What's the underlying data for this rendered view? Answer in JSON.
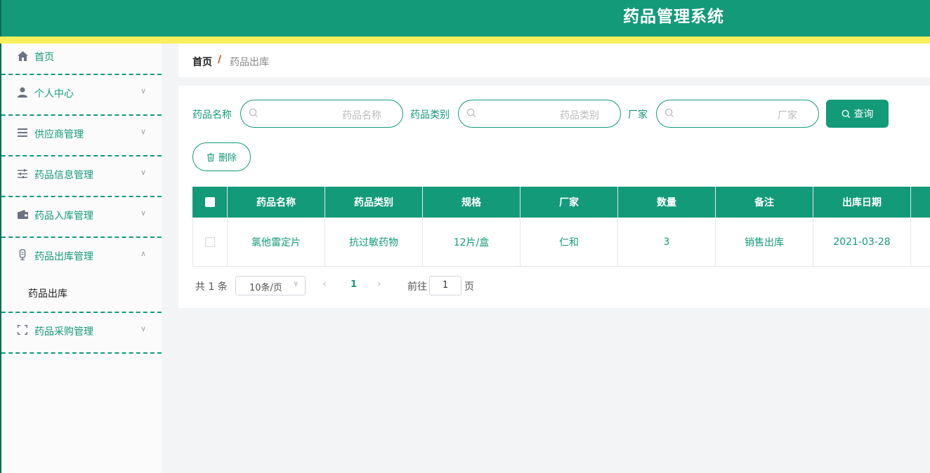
{
  "app": {
    "title": "药品管理系统"
  },
  "sidebar": {
    "items": [
      {
        "label": "首页",
        "icon": "home-icon"
      },
      {
        "label": "个人中心",
        "icon": "user-icon"
      },
      {
        "label": "供应商管理",
        "icon": "list-icon"
      },
      {
        "label": "药品信息管理",
        "icon": "sliders-icon"
      },
      {
        "label": "药品入库管理",
        "icon": "wallet-icon"
      },
      {
        "label": "药品出库管理",
        "icon": "mic-icon",
        "expanded": true,
        "children": [
          {
            "label": "药品出库"
          }
        ]
      },
      {
        "label": "药品采购管理",
        "icon": "fullscreen-icon"
      }
    ]
  },
  "breadcrumb": {
    "home": "首页",
    "separator": "/",
    "current": "药品出库"
  },
  "filters": [
    {
      "label": "药品名称",
      "placeholder": "药品名称"
    },
    {
      "label": "药品类别",
      "placeholder": "药品类别"
    },
    {
      "label": "厂家",
      "placeholder": "厂家"
    }
  ],
  "actions": {
    "search_label": "查询",
    "delete_label": "删除"
  },
  "table": {
    "columns": [
      "药品名称",
      "药品类别",
      "规格",
      "厂家",
      "数量",
      "备注",
      "出库日期"
    ],
    "rows": [
      {
        "name": "氯他雷定片",
        "category": "抗过敏药物",
        "spec": "12片/盒",
        "maker": "仁和",
        "qty": "3",
        "note": "销售出库",
        "date": "2021-03-28"
      }
    ]
  },
  "pagination": {
    "total": "共 1 条",
    "page_size": "10条/页",
    "current_page": "1",
    "goto_label": "前往",
    "goto_value": "1",
    "page_suffix": "页"
  },
  "colors": {
    "primary": "#139a79",
    "stripe": "#f8ef5c"
  }
}
